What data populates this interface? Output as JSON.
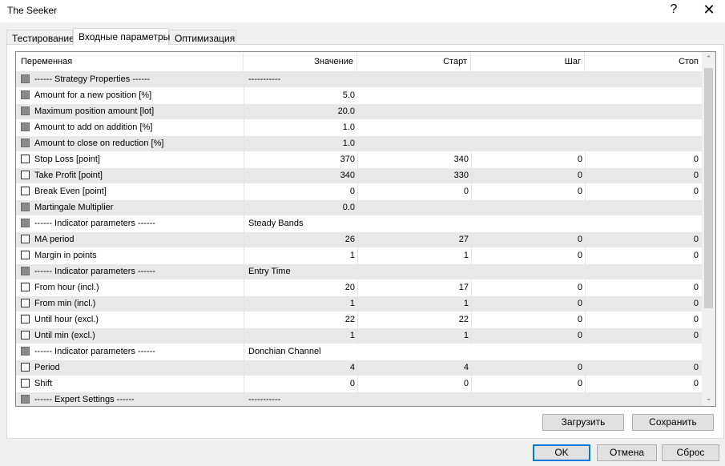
{
  "window": {
    "title": "The Seeker",
    "help_glyph": "?",
    "close_glyph": "✕"
  },
  "tabs": [
    {
      "label": "Тестирование"
    },
    {
      "label": "Входные параметры"
    },
    {
      "label": "Оптимизация"
    }
  ],
  "grid": {
    "columns": [
      "Переменная",
      "Значение",
      "Старт",
      "Шаг",
      "Стоп"
    ],
    "rows": [
      {
        "name": "------ Strategy Properties ------",
        "value": "-----------",
        "start": "",
        "step": "",
        "stop": "",
        "checkbox": "disabled",
        "kind": "sep"
      },
      {
        "name": "Amount for a new position [%]",
        "value": "5.0",
        "start": "",
        "step": "",
        "stop": "",
        "checkbox": "disabled",
        "kind": "noopt"
      },
      {
        "name": "Maximum position amount [lot]",
        "value": "20.0",
        "start": "",
        "step": "",
        "stop": "",
        "checkbox": "disabled",
        "kind": "noopt"
      },
      {
        "name": "Amount to add on addition [%]",
        "value": "1.0",
        "start": "",
        "step": "",
        "stop": "",
        "checkbox": "disabled",
        "kind": "noopt"
      },
      {
        "name": "Amount to close on reduction [%]",
        "value": "1.0",
        "start": "",
        "step": "",
        "stop": "",
        "checkbox": "disabled",
        "kind": "noopt"
      },
      {
        "name": "Stop Loss [point]",
        "value": "370",
        "start": "340",
        "step": "0",
        "stop": "0",
        "checkbox": "unchecked",
        "kind": "opt"
      },
      {
        "name": "Take Profit [point]",
        "value": "340",
        "start": "330",
        "step": "0",
        "stop": "0",
        "checkbox": "unchecked",
        "kind": "opt"
      },
      {
        "name": "Break Even [point]",
        "value": "0",
        "start": "0",
        "step": "0",
        "stop": "0",
        "checkbox": "unchecked",
        "kind": "opt"
      },
      {
        "name": "Martingale Multiplier",
        "value": "0.0",
        "start": "",
        "step": "",
        "stop": "",
        "checkbox": "disabled",
        "kind": "noopt"
      },
      {
        "name": "------ Indicator parameters ------",
        "value": "Steady Bands",
        "start": "",
        "step": "",
        "stop": "",
        "checkbox": "disabled",
        "kind": "sep"
      },
      {
        "name": "MA period",
        "value": "26",
        "start": "27",
        "step": "0",
        "stop": "0",
        "checkbox": "unchecked",
        "kind": "opt"
      },
      {
        "name": "Margin in points",
        "value": "1",
        "start": "1",
        "step": "0",
        "stop": "0",
        "checkbox": "unchecked",
        "kind": "opt"
      },
      {
        "name": "------ Indicator parameters ------",
        "value": "Entry Time",
        "start": "",
        "step": "",
        "stop": "",
        "checkbox": "disabled",
        "kind": "sep"
      },
      {
        "name": "From hour (incl.)",
        "value": "20",
        "start": "17",
        "step": "0",
        "stop": "0",
        "checkbox": "unchecked",
        "kind": "opt"
      },
      {
        "name": "From min (incl.)",
        "value": "1",
        "start": "1",
        "step": "0",
        "stop": "0",
        "checkbox": "unchecked",
        "kind": "opt"
      },
      {
        "name": "Until hour (excl.)",
        "value": "22",
        "start": "22",
        "step": "0",
        "stop": "0",
        "checkbox": "unchecked",
        "kind": "opt"
      },
      {
        "name": "Until min (excl.)",
        "value": "1",
        "start": "1",
        "step": "0",
        "stop": "0",
        "checkbox": "unchecked",
        "kind": "opt"
      },
      {
        "name": "------ Indicator parameters ------",
        "value": "Donchian Channel",
        "start": "",
        "step": "",
        "stop": "",
        "checkbox": "disabled",
        "kind": "sep"
      },
      {
        "name": "Period",
        "value": "4",
        "start": "4",
        "step": "0",
        "stop": "0",
        "checkbox": "unchecked",
        "kind": "opt"
      },
      {
        "name": "Shift",
        "value": "0",
        "start": "0",
        "step": "0",
        "stop": "0",
        "checkbox": "unchecked",
        "kind": "opt"
      },
      {
        "name": "------ Expert Settings ------",
        "value": "-----------",
        "start": "",
        "step": "",
        "stop": "",
        "checkbox": "disabled",
        "kind": "sep"
      }
    ]
  },
  "scrollbar": {
    "up_glyph": "⌃",
    "down_glyph": "⌄"
  },
  "panel_buttons": {
    "load": "Загрузить",
    "save": "Сохранить"
  },
  "dialog_buttons": {
    "ok": "OK",
    "cancel": "Отмена",
    "reset": "Сброс"
  }
}
